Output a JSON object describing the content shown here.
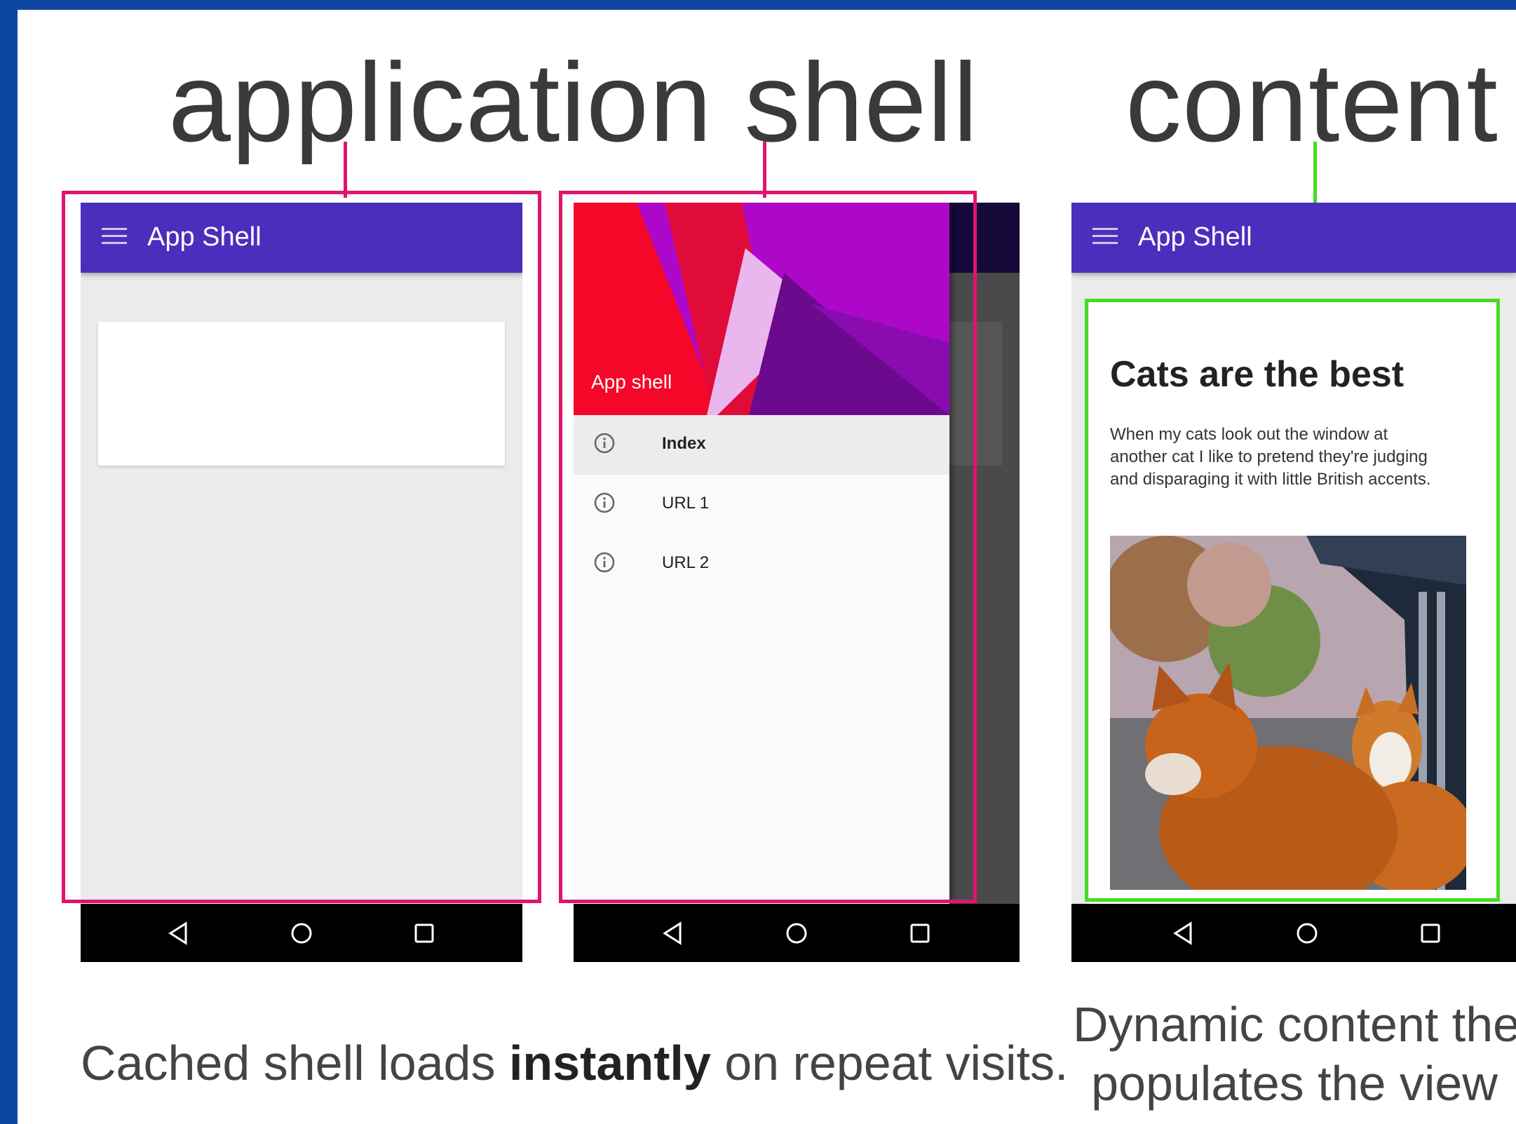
{
  "headings": {
    "left": "application shell",
    "right": "content"
  },
  "captions": {
    "left_pre": "Cached shell loads ",
    "left_bold": "instantly",
    "left_post": " on repeat visits.",
    "right_line1": "Dynamic content then",
    "right_line2": "populates the view"
  },
  "phone1": {
    "appbar_title": "App Shell",
    "menu_icon": "menu-icon"
  },
  "phone2": {
    "drawer_header_label": "App shell",
    "drawer_items": [
      {
        "label": "Index",
        "icon": "info-icon",
        "selected": true
      },
      {
        "label": "URL 1",
        "icon": "info-icon",
        "selected": false
      },
      {
        "label": "URL 2",
        "icon": "info-icon",
        "selected": false
      }
    ]
  },
  "phone3": {
    "appbar_title": "App Shell",
    "article_title": "Cats are the best",
    "article_body": "When my cats look out the window at another cat I like to pretend they're judging and disparaging it with little British accents.",
    "image": "cats-at-window-photo"
  },
  "colors": {
    "slide_border": "#0d47a1",
    "appbar": "#4a2fbd",
    "shell_outline": "#e0146e",
    "content_outline": "#44dd22"
  }
}
